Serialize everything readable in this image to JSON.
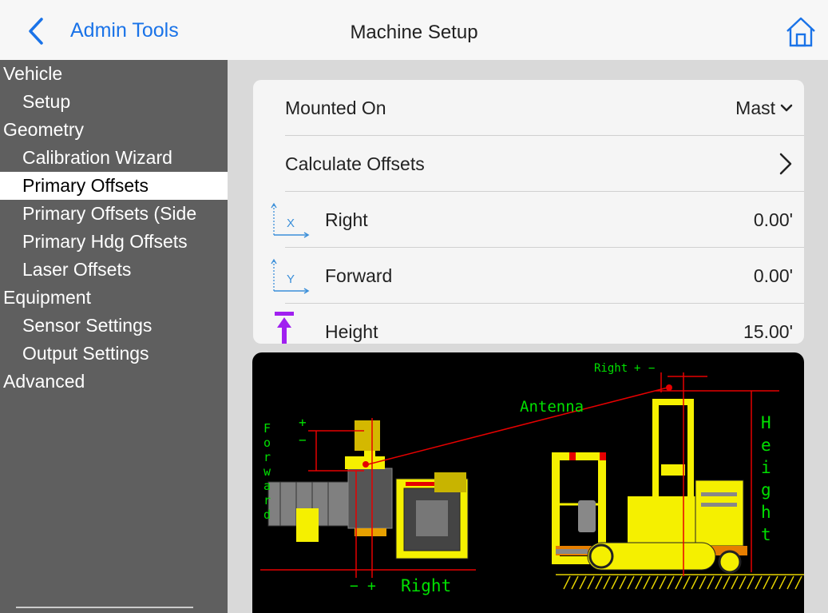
{
  "header": {
    "back_label": "Admin Tools",
    "title": "Machine Setup"
  },
  "sidebar": {
    "items": [
      {
        "label": "Vehicle",
        "type": "header"
      },
      {
        "label": "Setup",
        "type": "sub"
      },
      {
        "label": "Geometry",
        "type": "header"
      },
      {
        "label": "Calibration Wizard",
        "type": "sub"
      },
      {
        "label": "Primary Offsets",
        "type": "sub",
        "selected": true
      },
      {
        "label": "Primary Offsets (Side",
        "type": "sub"
      },
      {
        "label": "Primary Hdg Offsets",
        "type": "sub"
      },
      {
        "label": "Laser Offsets",
        "type": "sub"
      },
      {
        "label": "Equipment",
        "type": "header"
      },
      {
        "label": "Sensor Settings",
        "type": "sub"
      },
      {
        "label": "Output Settings",
        "type": "sub"
      },
      {
        "label": "Advanced",
        "type": "header"
      }
    ]
  },
  "settings": {
    "mounted_on": {
      "label": "Mounted On",
      "value": "Mast"
    },
    "calculate_offsets": {
      "label": "Calculate Offsets"
    },
    "right": {
      "label": "Right",
      "axis": "X",
      "value": "0.00'"
    },
    "forward": {
      "label": "Forward",
      "axis": "Y",
      "value": "0.00'"
    },
    "height": {
      "label": "Height",
      "value": "15.00'"
    }
  },
  "diagram": {
    "forward": "Forward",
    "antenna": "Antenna",
    "right_top": "Right",
    "right_bottom": "Right",
    "height": "Height",
    "plus": "+",
    "minus": "−"
  },
  "colors": {
    "accent": "#1a73e8",
    "sidebar_bg": "#5f5f5f",
    "diagram_bg": "#000000",
    "height_icon": "#a020f0",
    "machine_yellow": "#f5f000",
    "dimension_red": "#e60000",
    "label_green": "#00e000"
  }
}
